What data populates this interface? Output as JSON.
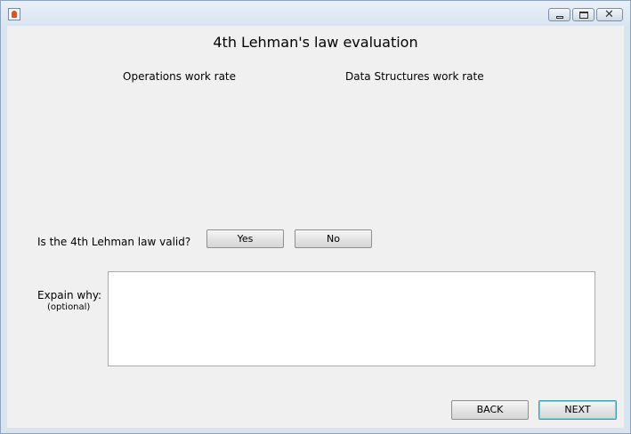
{
  "window": {
    "icon": "java-cup-icon",
    "controls": [
      "minimize-icon",
      "maximize-icon",
      "close-icon"
    ],
    "close_glyph": "✕"
  },
  "main": {
    "title": "4th Lehman's law evaluation",
    "column_labels": {
      "operations": "Operations work rate",
      "data_structures": "Data Structures work rate"
    },
    "question": "Is the 4th Lehman law valid?",
    "answer_buttons": {
      "yes": "Yes",
      "no": "No"
    },
    "explain_label": "Expain why:",
    "explain_hint": "(optional)",
    "explain_value": ""
  },
  "footer": {
    "back_label": "BACK",
    "next_label": "NEXT"
  }
}
